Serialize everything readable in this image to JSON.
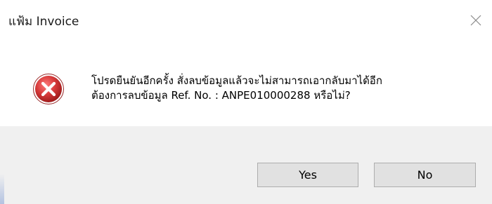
{
  "dialog": {
    "title": "แฟ้ม Invoice",
    "close_glyph": "×",
    "icon": "error-icon",
    "message_line1": "โปรดยืนยันอีกครั้ง สั่งลบข้อมูลแล้วจะไม่สามารถเอากลับมาได้อีก",
    "message_line2": "ต้องการลบข้อมูล Ref. No. : ANPE010000288 หรือไม่?",
    "buttons": {
      "yes_label": "Yes",
      "no_label": "No"
    }
  },
  "colors": {
    "error_red": "#c72c2c",
    "footer_bg": "#f0f0f0",
    "button_bg": "#e1e1e1",
    "button_border": "#adadad"
  }
}
